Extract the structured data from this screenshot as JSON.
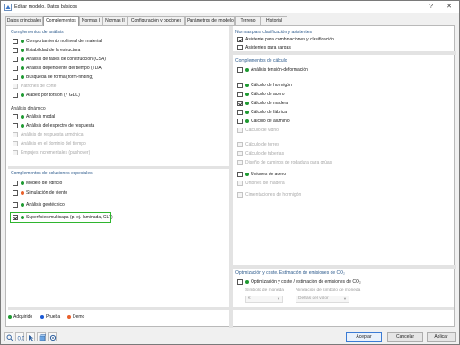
{
  "window": {
    "title": "Editar modelo. Datos básicos",
    "help_label": "?",
    "close_label": "✕"
  },
  "tabs": [
    {
      "label": "Datos principales"
    },
    {
      "label": "Complementos"
    },
    {
      "label": "Normas I"
    },
    {
      "label": "Normas II"
    },
    {
      "label": "Configuración y opciones"
    },
    {
      "label": "Parámetros del modelo"
    },
    {
      "label": "Terreno"
    },
    {
      "label": "Historial"
    }
  ],
  "active_tab": "Complementos",
  "analysis": {
    "title": "Complementos de análisis",
    "items": [
      {
        "label": "Comportamiento no lineal del material",
        "checked": false,
        "dot": "green",
        "disabled": false
      },
      {
        "label": "Estabilidad de la estructura",
        "checked": false,
        "dot": "green",
        "disabled": false
      },
      {
        "label": "Análisis de fases de construcción (CSA)",
        "checked": false,
        "dot": "green",
        "disabled": false
      },
      {
        "label": "Análisis dependiente del tiempo (TDA)",
        "checked": false,
        "dot": "green",
        "disabled": false
      },
      {
        "label": "Búsqueda de forma (form-finding)",
        "checked": false,
        "dot": "green",
        "disabled": false
      },
      {
        "label": "Patrones de corte",
        "checked": false,
        "dot": "none",
        "disabled": true
      },
      {
        "label": "Alabeo por torsión (7 GDL)",
        "checked": false,
        "dot": "green",
        "disabled": false
      }
    ],
    "dynamic_title": "Análisis dinámico",
    "dynamic_items": [
      {
        "label": "Análisis modal",
        "checked": false,
        "dot": "green",
        "disabled": false
      },
      {
        "label": "Análisis del espectro de respuesta",
        "checked": false,
        "dot": "green",
        "disabled": false
      },
      {
        "label": "Análisis de respuesta armónica",
        "checked": false,
        "dot": "none",
        "disabled": true
      },
      {
        "label": "Análisis en el dominio del tiempo",
        "checked": false,
        "dot": "none",
        "disabled": true
      },
      {
        "label": "Empujes incrementales (pushover)",
        "checked": false,
        "dot": "none",
        "disabled": true
      }
    ]
  },
  "special": {
    "title": "Complementos de soluciones especiales",
    "items": [
      {
        "label": "Modelo de edificio",
        "checked": false,
        "dot": "green",
        "disabled": false
      },
      {
        "label": "Simulación de viento",
        "checked": false,
        "dot": "orange",
        "disabled": false
      },
      {
        "label": "Análisis geotécnico",
        "checked": false,
        "dot": "green",
        "disabled": false
      },
      {
        "label": "Superficies multicapa (p. ej. laminada, CLT)",
        "checked": true,
        "dot": "green",
        "disabled": false,
        "highlighted": true
      }
    ]
  },
  "norms": {
    "title": "Normas para clasificación y asistentes",
    "items": [
      {
        "label": "Asistente para combinaciones y clasificación",
        "checked": true,
        "disabled": false
      },
      {
        "label": "Asistentes para cargas",
        "checked": false,
        "disabled": false
      }
    ]
  },
  "calc": {
    "title": "Complementos de cálculo",
    "items": [
      {
        "label": "Análisis tensión-deformación",
        "checked": false,
        "dot": "green",
        "disabled": false
      },
      {
        "label": "Cálculo de hormigón",
        "checked": false,
        "dot": "green",
        "disabled": false
      },
      {
        "label": "Cálculo de acero",
        "checked": false,
        "dot": "green",
        "disabled": false
      },
      {
        "label": "Cálculo de madera",
        "checked": true,
        "dot": "green",
        "disabled": false
      },
      {
        "label": "Cálculo de fábrica",
        "checked": false,
        "dot": "green",
        "disabled": false
      },
      {
        "label": "Cálculo de aluminio",
        "checked": false,
        "dot": "green",
        "disabled": false
      },
      {
        "label": "Cálculo de vidrio",
        "checked": false,
        "dot": "none",
        "disabled": true
      },
      {
        "label": "Cálculo de torres",
        "checked": false,
        "dot": "none",
        "disabled": true
      },
      {
        "label": "Cálculo de tuberías",
        "checked": false,
        "dot": "none",
        "disabled": true
      },
      {
        "label": "Diseño de caminos de rodadura para grúas",
        "checked": false,
        "dot": "none",
        "disabled": true
      },
      {
        "label": "Uniones de acero",
        "checked": false,
        "dot": "green",
        "disabled": false
      },
      {
        "label": "Uniones de madera",
        "checked": false,
        "dot": "none",
        "disabled": true
      },
      {
        "label": "Cimentaciones de hormigón",
        "checked": false,
        "dot": "none",
        "disabled": true
      }
    ]
  },
  "co2": {
    "title": "Optimización y coste. Estimación de emisiones de CO₂",
    "item_label": "Optimización y coste / estimación de emisiones de CO₂",
    "currency_symbol_label": "Símbolo de moneda",
    "currency_symbol_value": "€",
    "currency_align_label": "Alineación de símbolo de moneda",
    "currency_align_value": "Detrás del valor"
  },
  "legend": [
    {
      "label": "Adquirido",
      "color": "#1f9a32"
    },
    {
      "label": "Prueba",
      "color": "#1b5ad6"
    },
    {
      "label": "Demo",
      "color": "#e8602c"
    }
  ],
  "buttons": {
    "accept": "Aceptar",
    "cancel": "Cancelar",
    "apply": "Aplicar"
  },
  "toolbar_icons": [
    "zoom-icon",
    "number-icon",
    "pointer-icon",
    "model-icon",
    "settings-icon"
  ]
}
